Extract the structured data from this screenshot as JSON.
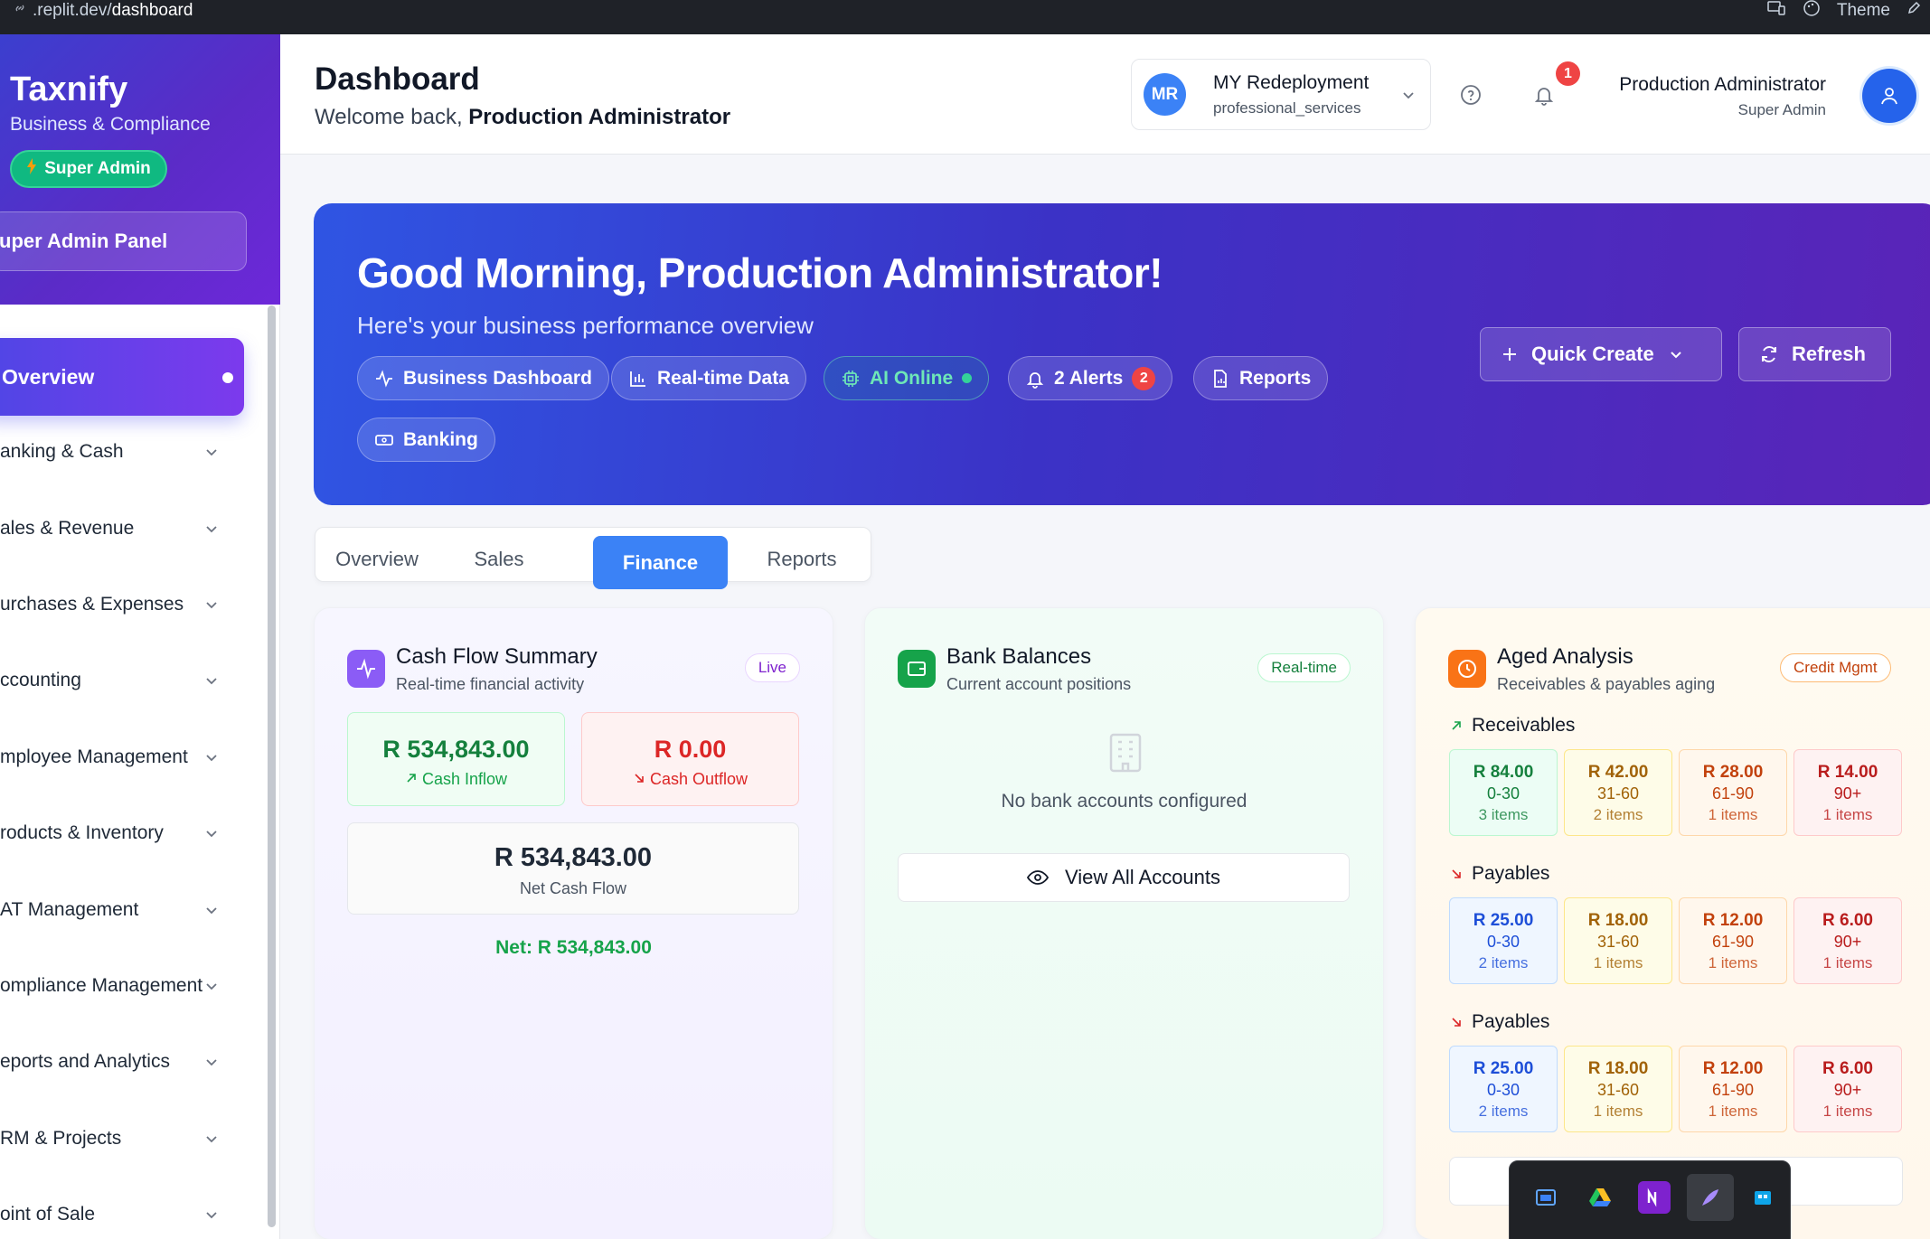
{
  "browser": {
    "url_prefix": ".replit.dev/",
    "url_path": "dashboard",
    "theme_label": "Theme"
  },
  "sidebar": {
    "brand": "Taxnify",
    "brand_sub": "Business & Compliance",
    "role_badge": "Super Admin",
    "panel_button": "uper Admin Panel",
    "items": [
      {
        "label": "Overview",
        "active": true
      },
      {
        "label": "anking & Cash"
      },
      {
        "label": "ales & Revenue"
      },
      {
        "label": "urchases & Expenses"
      },
      {
        "label": "ccounting"
      },
      {
        "label": "mployee Management"
      },
      {
        "label": "roducts & Inventory"
      },
      {
        "label": "AT Management"
      },
      {
        "label": "ompliance Management"
      },
      {
        "label": "eports and Analytics"
      },
      {
        "label": "RM & Projects"
      },
      {
        "label": "oint of Sale"
      }
    ]
  },
  "header": {
    "title": "Dashboard",
    "welcome_prefix": "Welcome back,",
    "welcome_name": "Production Administrator",
    "org": {
      "initials": "MR",
      "name": "MY Redeployment",
      "type": "professional_services"
    },
    "notification_count": "1",
    "user": {
      "name": "Production Administrator",
      "role": "Super Admin"
    }
  },
  "hero": {
    "title": "Good Morning, Production Administrator!",
    "subtitle": "Here's your business performance overview",
    "chips": {
      "business": "Business Dashboard",
      "realtime": "Real-time Data",
      "ai": "AI Online",
      "alerts": "2 Alerts",
      "alerts_count": "2",
      "reports": "Reports",
      "banking": "Banking"
    },
    "quick_create": "Quick Create",
    "refresh": "Refresh"
  },
  "tabs": [
    {
      "label": "Overview"
    },
    {
      "label": "Sales"
    },
    {
      "label": "Finance",
      "active": true
    },
    {
      "label": "Reports"
    }
  ],
  "cash_flow": {
    "title": "Cash Flow Summary",
    "subtitle": "Real-time financial activity",
    "badge": "Live",
    "inflow_value": "R 534,843.00",
    "inflow_label": "Cash Inflow",
    "outflow_value": "R 0.00",
    "outflow_label": "Cash Outflow",
    "net_value": "R 534,843.00",
    "net_label": "Net Cash Flow",
    "net_line": "Net: R 534,843.00"
  },
  "bank": {
    "title": "Bank Balances",
    "subtitle": "Current account positions",
    "badge": "Real-time",
    "empty": "No bank accounts configured",
    "view_all": "View All Accounts"
  },
  "aged": {
    "title": "Aged Analysis",
    "subtitle": "Receivables & payables aging",
    "badge": "Credit Mgmt",
    "sections": [
      {
        "label": "Receivables",
        "buckets": [
          {
            "amount": "R 84.00",
            "range": "0-30",
            "count": "3 items"
          },
          {
            "amount": "R 42.00",
            "range": "31-60",
            "count": "2 items"
          },
          {
            "amount": "R 28.00",
            "range": "61-90",
            "count": "1 items"
          },
          {
            "amount": "R 14.00",
            "range": "90+",
            "count": "1 items"
          }
        ]
      },
      {
        "label": "Payables",
        "buckets": [
          {
            "amount": "R 25.00",
            "range": "0-30",
            "count": "2 items"
          },
          {
            "amount": "R 18.00",
            "range": "31-60",
            "count": "1 items"
          },
          {
            "amount": "R 12.00",
            "range": "61-90",
            "count": "1 items"
          },
          {
            "amount": "R 6.00",
            "range": "90+",
            "count": "1 items"
          }
        ]
      },
      {
        "label": "Payables",
        "buckets": [
          {
            "amount": "R 25.00",
            "range": "0-30",
            "count": "2 items"
          },
          {
            "amount": "R 18.00",
            "range": "31-60",
            "count": "1 items"
          },
          {
            "amount": "R 12.00",
            "range": "61-90",
            "count": "1 items"
          },
          {
            "amount": "R 6.00",
            "range": "90+",
            "count": "1 items"
          }
        ]
      }
    ]
  }
}
